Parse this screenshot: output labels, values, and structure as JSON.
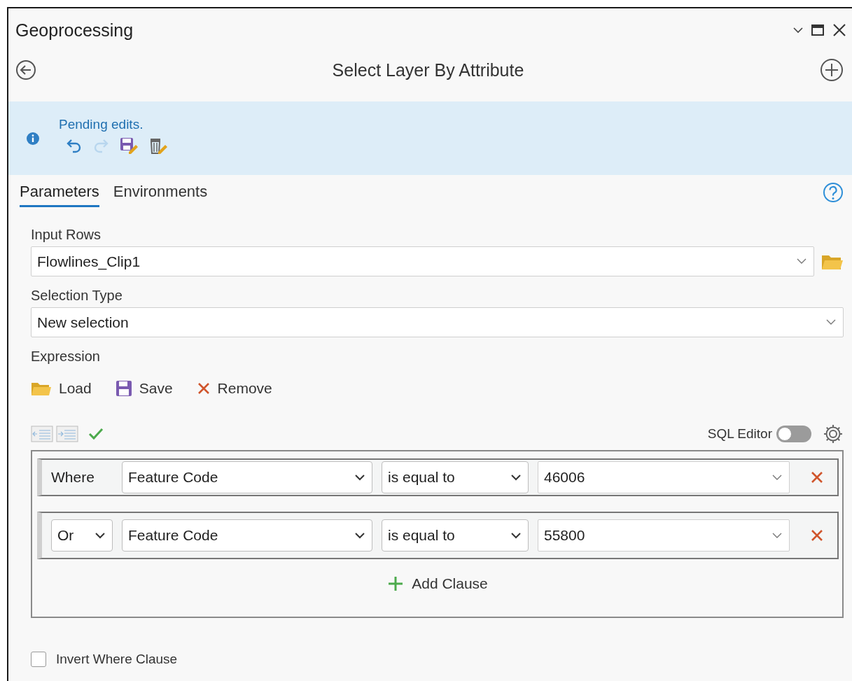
{
  "window": {
    "title": "Geoprocessing"
  },
  "tool": {
    "title": "Select Layer By Attribute"
  },
  "banner": {
    "message": "Pending edits.",
    "actions": [
      {
        "kind": "undo",
        "disabled": false
      },
      {
        "kind": "redo",
        "disabled": true
      },
      {
        "kind": "save",
        "disabled": false
      },
      {
        "kind": "discard",
        "disabled": false
      }
    ]
  },
  "tabs": [
    {
      "label": "Parameters",
      "selected": true
    },
    {
      "label": "Environments",
      "selected": false
    }
  ],
  "parameters": [
    {
      "label": "Input Rows",
      "value": "Flowlines_Clip1",
      "browse": true
    },
    {
      "label": "Selection Type",
      "value": "New selection",
      "browse": false
    }
  ],
  "expression": {
    "label": "Expression",
    "actions": [
      {
        "kind": "load",
        "label": "Load"
      },
      {
        "kind": "save",
        "label": "Save"
      },
      {
        "kind": "remove",
        "label": "Remove"
      }
    ],
    "valid": true,
    "sql_editor": {
      "label": "SQL Editor",
      "on": false
    },
    "clauses": [
      {
        "kind": "where",
        "connector": "Where",
        "field": "Feature Code",
        "operator": "is equal to",
        "value": "46006"
      },
      {
        "kind": "combine",
        "connector": "Or",
        "field": "Feature Code",
        "operator": "is equal to",
        "value": "55800"
      }
    ],
    "add_clause": "Add Clause"
  },
  "invert": {
    "label": "Invert Where Clause",
    "checked": false
  }
}
